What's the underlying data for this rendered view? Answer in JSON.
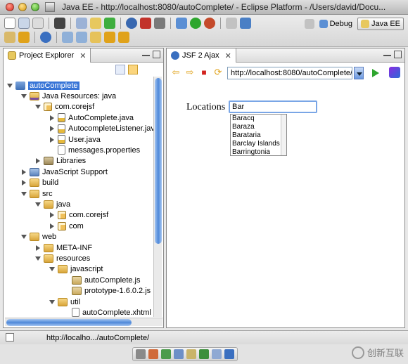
{
  "window": {
    "title": "Java EE - http://localhost:8080/autoComplete/ - Eclipse Platform - /Users/david/Docu..."
  },
  "perspectives": {
    "debug_label": "Debug",
    "javaee_label": "Java EE"
  },
  "explorer": {
    "tab_label": "Project Explorer",
    "tree": [
      {
        "label": "autoComplete",
        "icon": "project-icon",
        "twisty": "open",
        "selected": true
      },
      {
        "label": "Java Resources: java",
        "icon": "source-folder-icon",
        "twisty": "open"
      },
      {
        "label": "com.corejsf",
        "icon": "package-icon",
        "twisty": "open"
      },
      {
        "label": "AutoComplete.java",
        "icon": "java-file-icon",
        "twisty": "closed"
      },
      {
        "label": "AutocompleteListener.jav",
        "icon": "java-file-icon",
        "twisty": "closed"
      },
      {
        "label": "User.java",
        "icon": "java-file-icon",
        "twisty": "closed"
      },
      {
        "label": "messages.properties",
        "icon": "properties-file-icon",
        "twisty": "none"
      },
      {
        "label": "Libraries",
        "icon": "library-icon",
        "twisty": "closed"
      },
      {
        "label": "JavaScript Support",
        "icon": "javascript-support-icon",
        "twisty": "closed"
      },
      {
        "label": "build",
        "icon": "folder-icon",
        "twisty": "closed"
      },
      {
        "label": "src",
        "icon": "folder-icon",
        "twisty": "open"
      },
      {
        "label": "java",
        "icon": "folder-icon",
        "twisty": "open"
      },
      {
        "label": "com.corejsf",
        "icon": "package-icon",
        "twisty": "closed"
      },
      {
        "label": "com",
        "icon": "package-icon",
        "twisty": "closed"
      },
      {
        "label": "web",
        "icon": "folder-icon",
        "twisty": "open"
      },
      {
        "label": "META-INF",
        "icon": "folder-icon",
        "twisty": "closed"
      },
      {
        "label": "resources",
        "icon": "folder-icon",
        "twisty": "open"
      },
      {
        "label": "javascript",
        "icon": "folder-icon",
        "twisty": "open"
      },
      {
        "label": "autoComplete.js",
        "icon": "js-file-icon",
        "twisty": "none"
      },
      {
        "label": "prototype-1.6.0.2.js",
        "icon": "js-file-icon",
        "twisty": "none"
      },
      {
        "label": "util",
        "icon": "folder-icon",
        "twisty": "open"
      },
      {
        "label": "autoComplete.xhtml",
        "icon": "xhtml-file-icon",
        "twisty": "none"
      }
    ]
  },
  "browser": {
    "tab_label": "JSF 2 Ajax",
    "url": "http://localhost:8080/autoComplete/",
    "page": {
      "field_label": "Locations",
      "input_value": "Bar",
      "suggestions": [
        "Baracq",
        "Baraza",
        "Barataria",
        "Barclay Islands",
        "Barringtonia"
      ]
    }
  },
  "status": {
    "text": "http://localho.../autoComplete/"
  },
  "watermark": {
    "text": "创新互联"
  },
  "colors": {
    "selection": "#3875d7",
    "input_focus": "#7aa6e6",
    "scroll_thumb": "#4e88d9"
  }
}
